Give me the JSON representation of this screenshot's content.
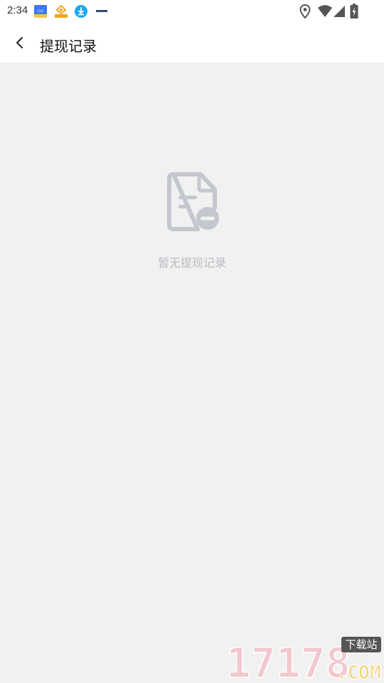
{
  "status_bar": {
    "time": "2:34",
    "notification_icons": [
      "app-icon-blue",
      "app-icon-orange",
      "download-icon",
      "small-logo-icon"
    ],
    "right_icons": [
      "location-icon",
      "wifi-icon",
      "signal-icon",
      "battery-icon"
    ]
  },
  "header": {
    "back_icon": "chevron-left-icon",
    "title": "提现记录"
  },
  "empty_state": {
    "icon": "document-minus-icon",
    "message": "暂无提现记录"
  },
  "watermark": {
    "brand": "17178",
    "badge": "下载站",
    "domain": ".COM"
  },
  "colors": {
    "background": "#f0f1f0",
    "bar": "#ffffff",
    "empty_icon": "#c4c7cd",
    "empty_text": "#b9bcc2"
  }
}
